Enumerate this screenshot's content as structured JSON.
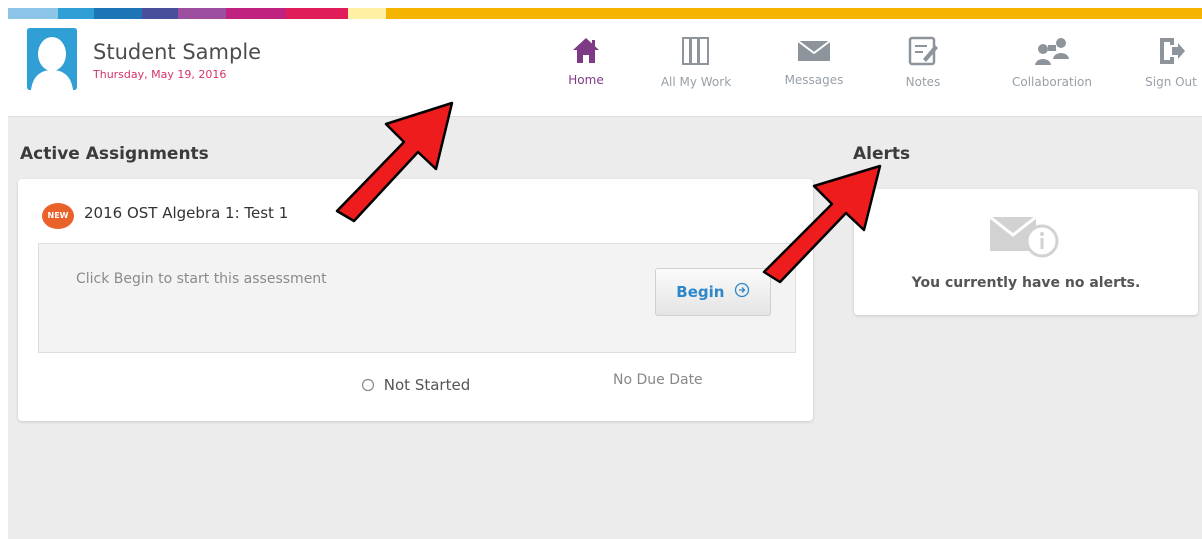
{
  "colors": {
    "strip": [
      "#8cc5e8",
      "#2f9fd6",
      "#1e75b6",
      "#4a4f9b",
      "#9c4f9e",
      "#c0227f",
      "#e11c5a",
      "#fff0a3",
      "#f4b400"
    ],
    "accent_purple": "#7f3a86",
    "date_pink": "#d6336c",
    "begin_blue": "#2e87c9",
    "new_orange": "#e8622a",
    "arrow_red": "#ee1c1c"
  },
  "header": {
    "user_name": "Student Sample",
    "date": "Thursday, May 19, 2016",
    "nav": [
      {
        "label": "Home",
        "icon": "home-icon",
        "active": true
      },
      {
        "label": "All My Work",
        "icon": "books-icon",
        "active": false
      },
      {
        "label": "Messages",
        "icon": "envelope-icon",
        "active": false
      },
      {
        "label": "Notes",
        "icon": "notes-icon",
        "active": false
      },
      {
        "label": "Collaboration",
        "icon": "collaboration-icon",
        "active": false
      },
      {
        "label": "Sign Out",
        "icon": "sign-out-icon",
        "active": false
      }
    ]
  },
  "assignments": {
    "title": "Active Assignments",
    "item": {
      "badge": "NEW",
      "name": "2016 OST Algebra 1: Test 1",
      "hint": "Click Begin to start this assessment",
      "begin_label": "Begin",
      "status": "Not Started",
      "due": "No Due Date"
    }
  },
  "alerts": {
    "title": "Alerts",
    "message": "You currently have no alerts.",
    "icon": "mail-info-icon"
  }
}
